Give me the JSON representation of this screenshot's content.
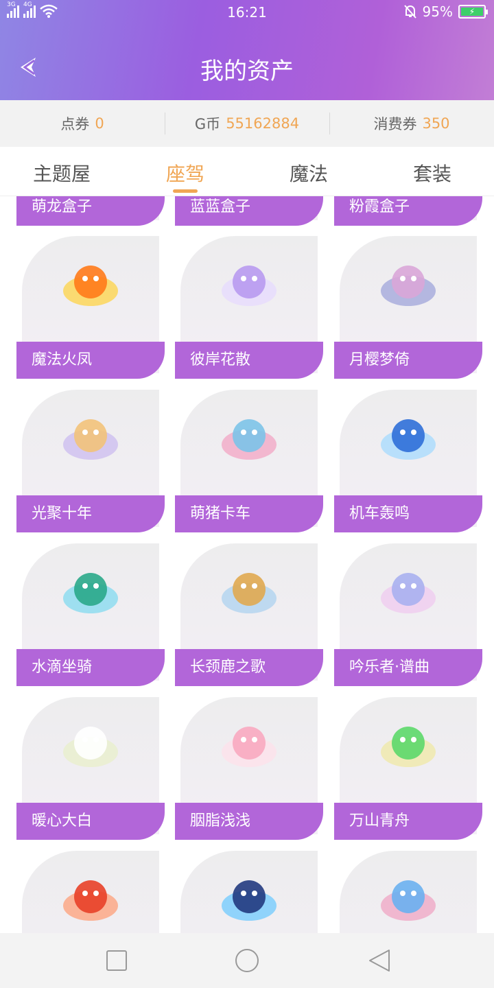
{
  "status_bar": {
    "time": "16:21",
    "battery": "95%",
    "net1": "3G",
    "net2": "4G"
  },
  "header": {
    "title": "我的资产",
    "back_icon": "back-arrow-icon"
  },
  "currency": [
    {
      "label": "点券",
      "value": "0"
    },
    {
      "label": "G币",
      "value": "55162884"
    },
    {
      "label": "消费券",
      "value": "350"
    }
  ],
  "tabs": [
    {
      "label": "主题屋",
      "active": false
    },
    {
      "label": "座驾",
      "active": true
    },
    {
      "label": "魔法",
      "active": false
    },
    {
      "label": "套装",
      "active": false
    }
  ],
  "partial_row": [
    "萌龙盒子",
    "蓝蓝盒子",
    "粉霞盒子"
  ],
  "items": [
    {
      "name": "魔法火凤",
      "icon": "fire-phoenix-icon"
    },
    {
      "name": "彼岸花散",
      "icon": "purple-cloud-icon"
    },
    {
      "name": "月樱梦倚",
      "icon": "cherry-blossom-icon"
    },
    {
      "name": "光聚十年",
      "icon": "golden-wing-icon"
    },
    {
      "name": "萌猪卡车",
      "icon": "pig-truck-icon"
    },
    {
      "name": "机车轰鸣",
      "icon": "blue-motorbike-icon"
    },
    {
      "name": "水滴坐骑",
      "icon": "water-drop-icon"
    },
    {
      "name": "长颈鹿之歌",
      "icon": "giraffe-icon"
    },
    {
      "name": "吟乐者·谱曲",
      "icon": "music-note-icon"
    },
    {
      "name": "暖心大白",
      "icon": "white-robot-icon"
    },
    {
      "name": "胭脂浅浅",
      "icon": "pink-cloud-icon"
    },
    {
      "name": "万山青舟",
      "icon": "green-boat-icon"
    },
    {
      "name": "",
      "icon": "red-lobster-icon"
    },
    {
      "name": "",
      "icon": "blue-cube-icon"
    },
    {
      "name": "",
      "icon": "blue-dragon-icon"
    }
  ],
  "nav": {
    "recent": "square-icon",
    "home": "circle-icon",
    "back": "triangle-back-icon"
  }
}
